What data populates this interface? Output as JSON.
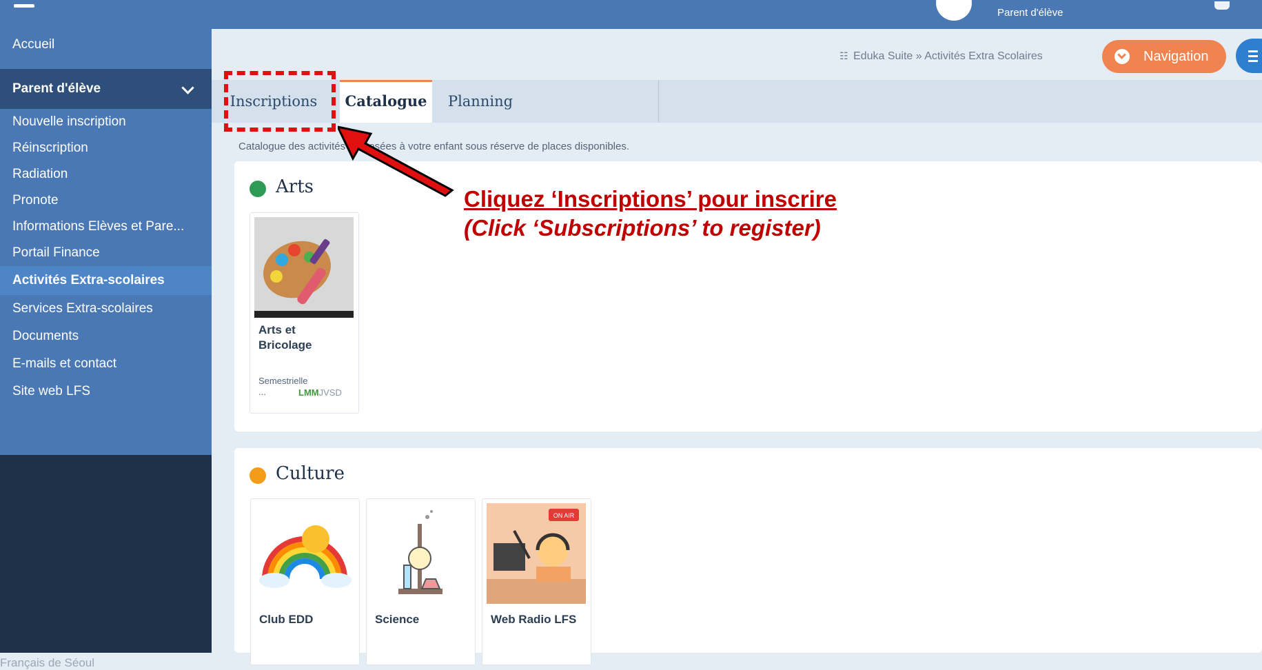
{
  "topbar": {
    "user_role": "Parent d'élève"
  },
  "sidebar": {
    "items": [
      {
        "label": "Accueil"
      },
      {
        "label": "Parent d'élève"
      },
      {
        "label": "Nouvelle inscription"
      },
      {
        "label": "Réinscription"
      },
      {
        "label": "Radiation"
      },
      {
        "label": "Pronote"
      },
      {
        "label": "Informations Elèves et Pare..."
      },
      {
        "label": "Portail Finance"
      },
      {
        "label": "Activités Extra-scolaires"
      },
      {
        "label": "Services Extra-scolaires"
      },
      {
        "label": "Documents"
      },
      {
        "label": "E-mails et contact"
      },
      {
        "label": "Site web LFS"
      }
    ],
    "footer": "Français de Séoul"
  },
  "header": {
    "breadcrumb": "Eduka Suite » Activités Extra Scolaires",
    "navigation_label": "Navigation"
  },
  "tabs": [
    {
      "label": "Inscriptions"
    },
    {
      "label": "Catalogue"
    },
    {
      "label": "Planning"
    }
  ],
  "catalogue_hint": "Catalogue des activités proposées à votre enfant sous réserve de places disponibles.",
  "sections": [
    {
      "title": "Arts",
      "color": "#2e9a56",
      "items": [
        {
          "name_line1": "Arts et",
          "name_line2": "Bricolage",
          "frequency": "Semestrielle",
          "more": "...",
          "days_on": "LMM",
          "days_off": "JVSD"
        }
      ]
    },
    {
      "title": "Culture",
      "color": "#f39c1a",
      "items": [
        {
          "name": "Club EDD"
        },
        {
          "name": "Science"
        },
        {
          "name": "Web Radio LFS",
          "badge": "ON AIR"
        }
      ]
    }
  ],
  "annotation": {
    "line1": "Cliquez ‘Inscriptions’ pour inscrire",
    "line2": "(Click ‘Subscriptions’ to register)",
    "color": "#c00000"
  }
}
